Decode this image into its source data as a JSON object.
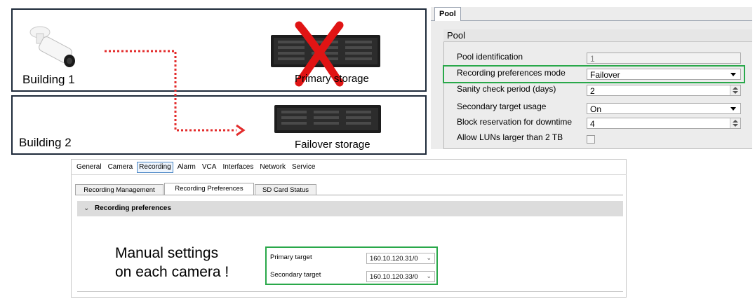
{
  "diagram": {
    "building1": "Building 1",
    "building2": "Building 2",
    "primary_storage": "Primary storage",
    "failover_storage": "Failover storage",
    "arrow_color": "#e32c2c",
    "cross_color": "#e01414"
  },
  "pool": {
    "tab": "Pool",
    "group_title": "Pool",
    "fields": [
      {
        "label": "Pool identification",
        "value": "1"
      },
      {
        "label": "Recording preferences mode",
        "value": "Failover"
      },
      {
        "label": "Sanity check period (days)",
        "value": "2"
      },
      {
        "label": "Secondary target usage",
        "value": "On"
      },
      {
        "label": "Block reservation for downtime",
        "value": "4"
      },
      {
        "label": "Allow LUNs larger than 2 TB",
        "value": ""
      }
    ],
    "highlight_color": "#29a84a"
  },
  "camera_config": {
    "menu": [
      "General",
      "Camera",
      "Recording",
      "Alarm",
      "VCA",
      "Interfaces",
      "Network",
      "Service"
    ],
    "active_menu": "Recording",
    "tabs": [
      "Recording Management",
      "Recording Preferences",
      "SD Card Status"
    ],
    "active_tab": "Recording Preferences",
    "section_title": "Recording preferences",
    "annotation_line1": "Manual settings",
    "annotation_line2": "on each camera !",
    "primary_target_label": "Primary target",
    "primary_target_value": "160.10.120.31/0",
    "secondary_target_label": "Secondary target",
    "secondary_target_value": "160.10.120.33/0"
  }
}
